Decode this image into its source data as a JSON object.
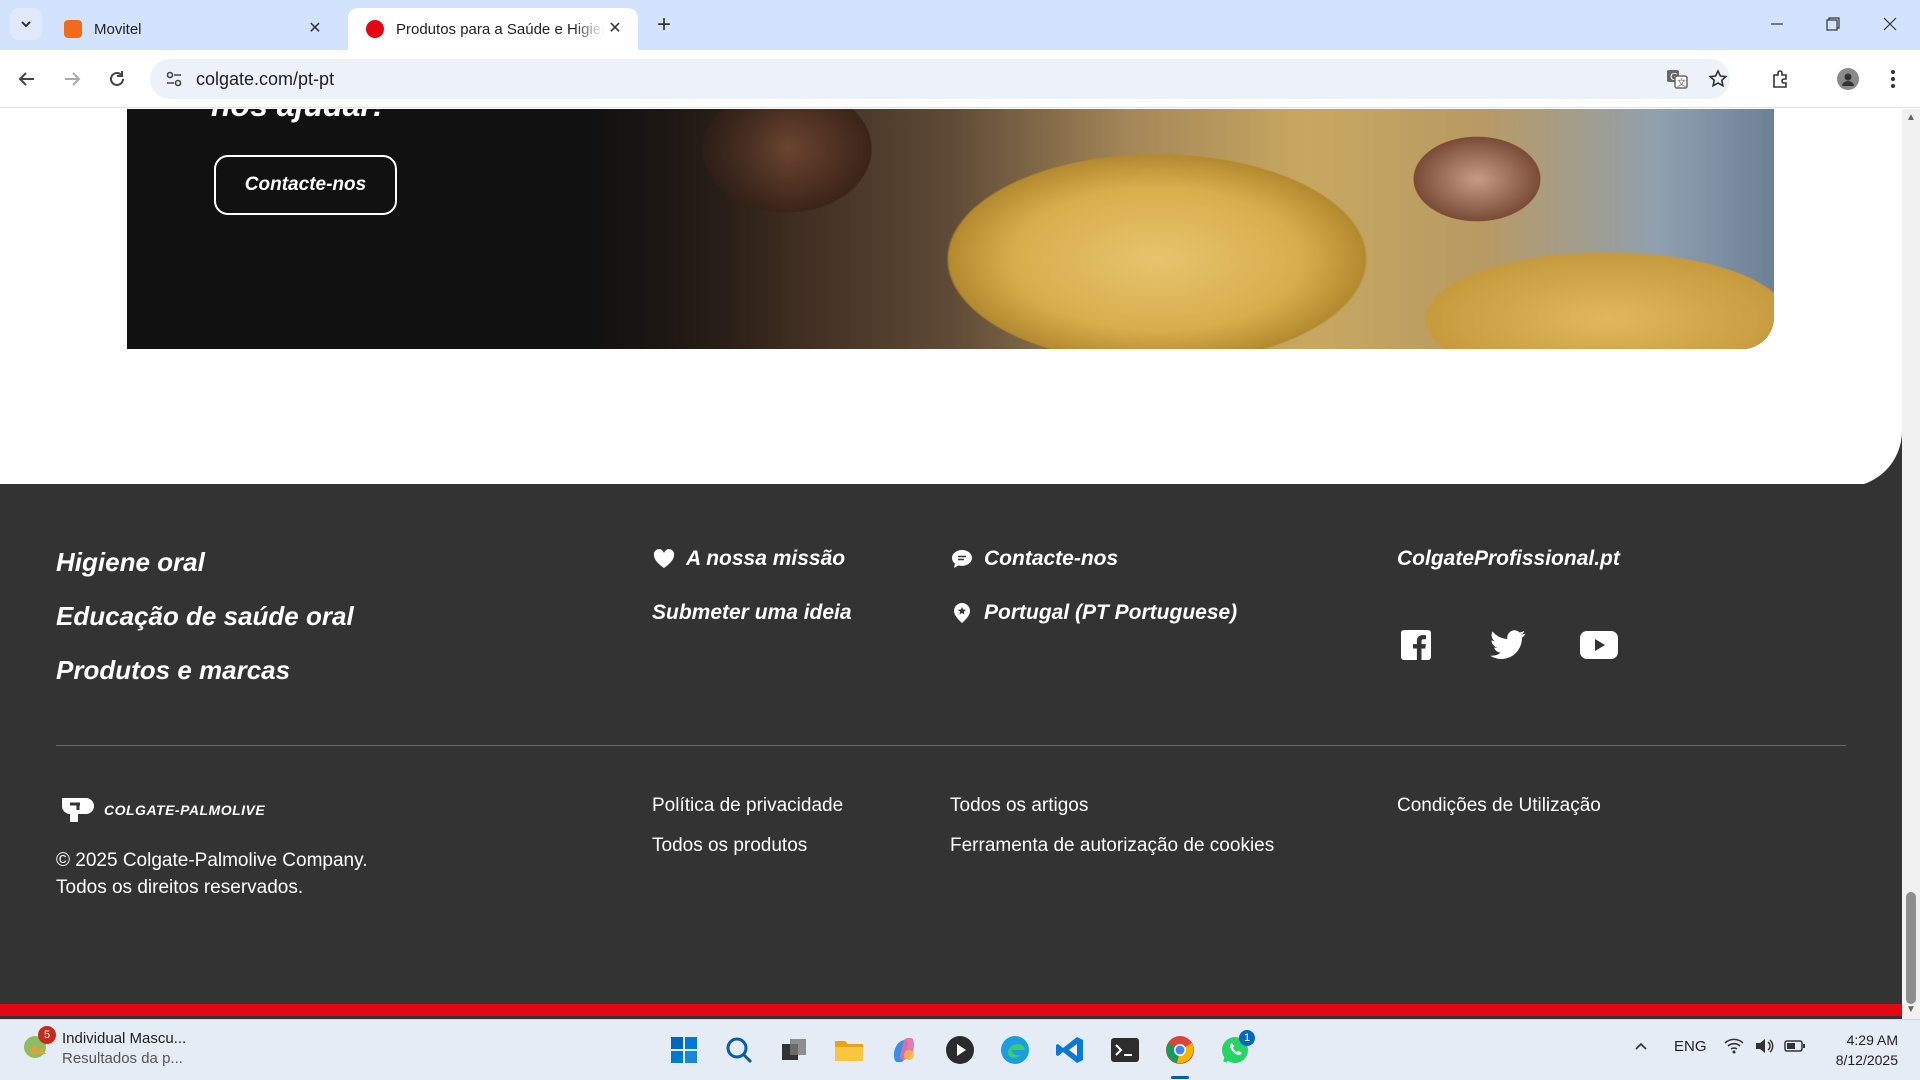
{
  "browser": {
    "tabs": [
      {
        "title": "Movitel"
      },
      {
        "title": "Produtos para a Saúde e Higiene"
      }
    ],
    "url": "colgate.com/pt-pt"
  },
  "hero": {
    "heading": "nos ajudar!",
    "button_label": "Contacte-nos"
  },
  "footer": {
    "main_links": [
      "Higiene oral",
      "Educação de saúde oral",
      "Produtos e marcas"
    ],
    "mission": "A nossa missão",
    "submit_idea": "Submeter uma ideia",
    "contact": "Contacte-nos",
    "region": "Portugal (PT Portuguese)",
    "professional": "ColgateProfissional.pt",
    "logo_text": "COLGATE-PALMOLIVE",
    "legal_links": {
      "privacy": "Política de privacidade",
      "all_products": "Todos os produtos",
      "all_articles": "Todos os artigos",
      "cookies": "Ferramenta de autorização de cookies",
      "terms": "Condições de Utilização"
    },
    "copyright_1": "© 2025 Colgate-Palmolive Company.",
    "copyright_2": "Todos os direitos reservados.",
    "accent_color": "#e30613"
  },
  "taskbar": {
    "notification": {
      "badge": "5",
      "title": "Individual Mascu...",
      "subtitle": "Resultados da p..."
    },
    "whatsapp_badge": "1",
    "language": "ENG",
    "time": "4:29 AM",
    "date": "8/12/2025"
  }
}
